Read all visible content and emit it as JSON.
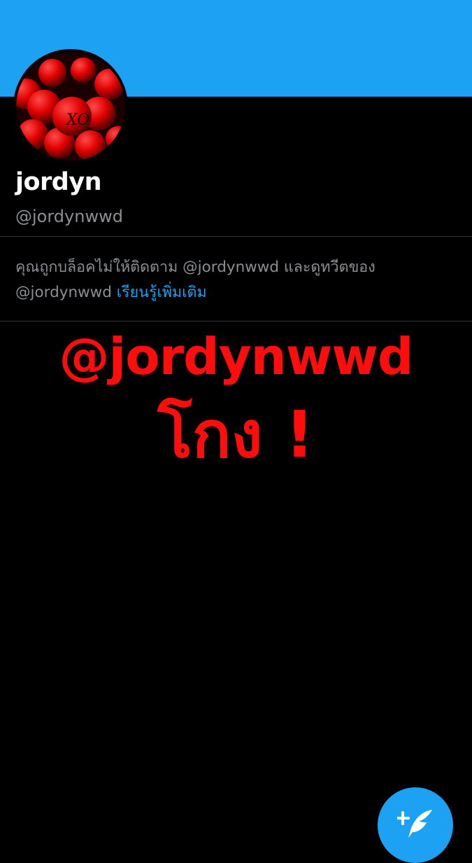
{
  "profile": {
    "display_name": "jordyn",
    "handle": "@jordynwwd",
    "avatar_text": "XO"
  },
  "blocked_notice": {
    "line1": "คุณถูกบล็อคไม่ให้ติดตาม @jordynwwd และดูทวีตของ",
    "line2_handle": "@jordynwwd",
    "learn_more": "เรียนรู้เพิ่มเติม"
  },
  "overlay": {
    "handle_text": "@jordynwwd",
    "cheat_text": "โกง !"
  },
  "compose_button": {
    "icon": "compose-tweet-icon"
  },
  "colors": {
    "banner": "#1da1f2",
    "background": "#000000",
    "link": "#1da1f2",
    "overlay_text": "#ff0d0d",
    "muted_text": "#8b8f93"
  }
}
